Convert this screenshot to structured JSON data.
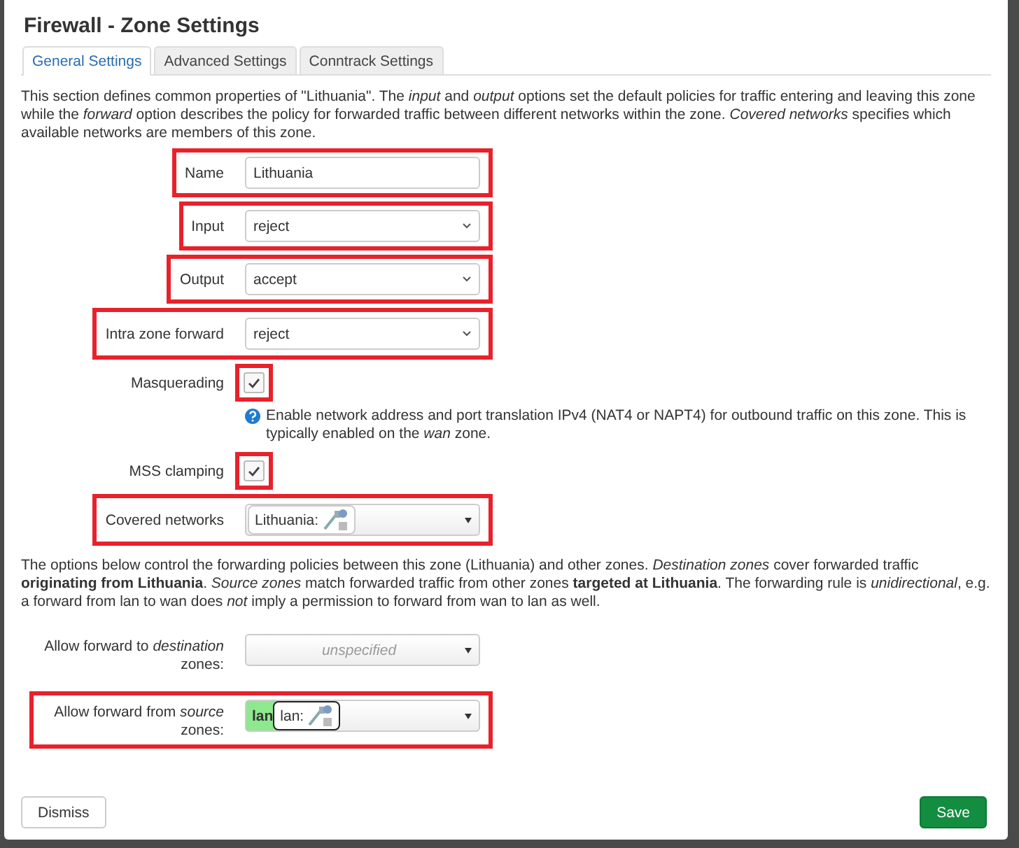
{
  "dialog": {
    "title": "Firewall - Zone Settings"
  },
  "tabs": [
    {
      "label": "General Settings",
      "selected": true
    },
    {
      "label": "Advanced Settings",
      "selected": false
    },
    {
      "label": "Conntrack Settings",
      "selected": false
    }
  ],
  "description": "This section defines common properties of \"Lithuania\". The *input* and *output* options set the default policies for traffic entering and leaving this zone while the *forward* option describes the policy for forwarded traffic between different networks within the zone. *Covered networks* specifies which available networks are members of this zone.",
  "fields": [
    {
      "kind": "text",
      "label": "Name",
      "value": "Lithuania",
      "highlighted": true
    },
    {
      "kind": "select",
      "label": "Input",
      "value": "reject",
      "highlighted": true
    },
    {
      "kind": "select",
      "label": "Output",
      "value": "accept",
      "highlighted": true
    },
    {
      "kind": "select",
      "label": "Intra zone forward",
      "value": "reject",
      "highlighted": true
    },
    {
      "kind": "checkbox",
      "label": "Masquerading",
      "checked": true,
      "highlighted": true,
      "help": "Enable network address and port translation IPv4 (NAT4 or NAPT4) for outbound traffic on this zone. This is typically enabled on the *wan* zone."
    },
    {
      "kind": "checkbox",
      "label": "MSS clamping",
      "checked": true,
      "highlighted": true
    },
    {
      "kind": "multiselect",
      "label": "Covered networks",
      "highlighted": true,
      "items": [
        {
          "kind": "network",
          "label": "Lithuania:",
          "focused": false
        }
      ]
    }
  ],
  "forwarding_description": "The options below control the forwarding policies between this zone (Lithuania) and other zones. *Destination zones* cover forwarded traffic **originating from Lithuania**. *Source zones* match forwarded traffic from other zones **targeted at Lithuania**. The forwarding rule is *unidirectional*, e.g. a forward from lan to wan does *not* imply a permission to forward from wan to lan as well.",
  "forward_fields": [
    {
      "kind": "multiselect",
      "label": "Allow forward to *destination* zones:",
      "placeholder": "unspecified",
      "highlighted": false
    },
    {
      "kind": "multiselect",
      "label": "Allow forward from *source* zones:",
      "highlighted": true,
      "items": [
        {
          "kind": "zone",
          "label": "lan",
          "color": "#8ee88e"
        },
        {
          "kind": "network",
          "label": "lan:",
          "focused": true
        }
      ]
    }
  ],
  "buttons": [
    {
      "label": "Dismiss",
      "primary": false
    },
    {
      "label": "Save",
      "primary": true
    }
  ]
}
